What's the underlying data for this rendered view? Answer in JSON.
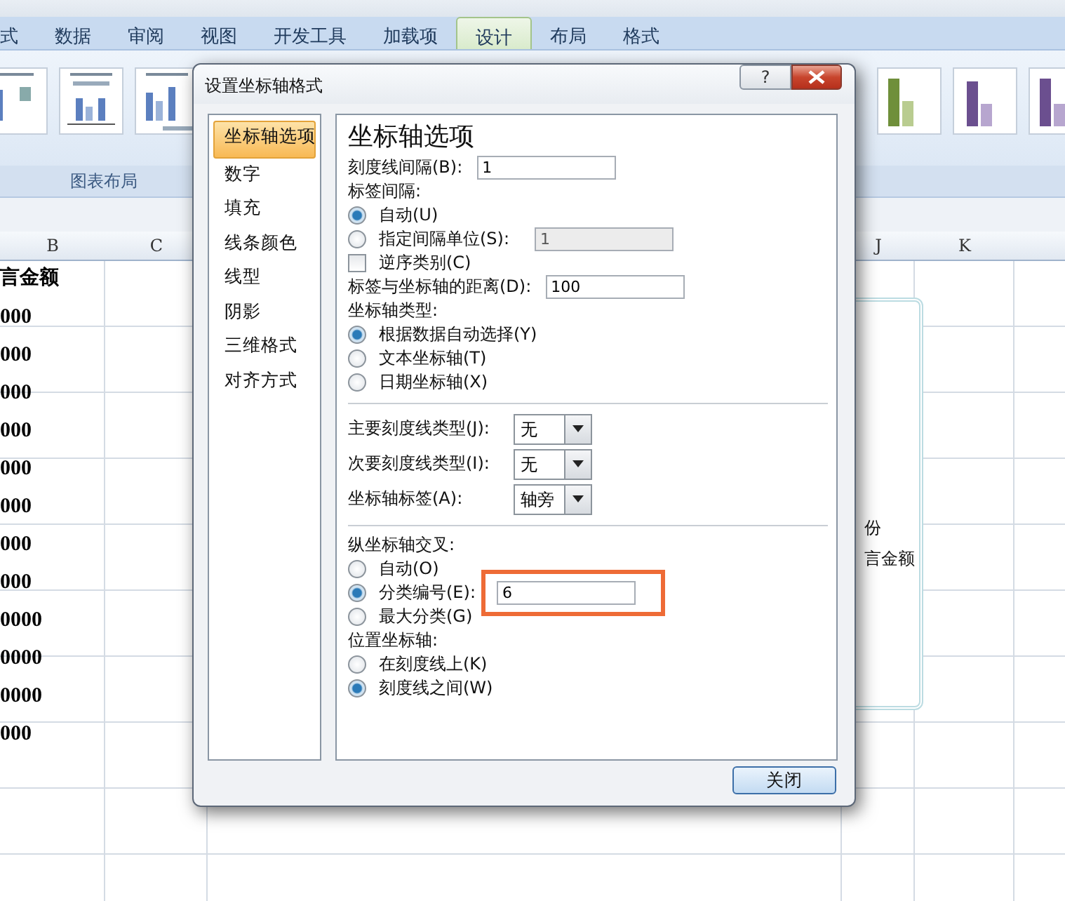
{
  "ribbon": {
    "tabs": [
      {
        "label": "式",
        "selected": false
      },
      {
        "label": "数据",
        "selected": false
      },
      {
        "label": "审阅",
        "selected": false
      },
      {
        "label": "视图",
        "selected": false
      },
      {
        "label": "开发工具",
        "selected": false
      },
      {
        "label": "加载项",
        "selected": false
      },
      {
        "label": "设计",
        "selected": true
      },
      {
        "label": "布局",
        "selected": false
      },
      {
        "label": "格式",
        "selected": false
      }
    ],
    "group_label": "图表布局"
  },
  "sheet": {
    "columns": [
      {
        "label": "B"
      },
      {
        "label": "C"
      },
      {
        "label": "J"
      },
      {
        "label": "K"
      }
    ],
    "column_b": [
      "言金额",
      "000",
      "000",
      "000",
      "000",
      "000",
      "000",
      "000",
      "000",
      "0000",
      "0000",
      "0000",
      "000"
    ],
    "legend": [
      "份",
      "言金额"
    ]
  },
  "dialog": {
    "title": "设置坐标轴格式",
    "help": "?",
    "nav": [
      {
        "label": "坐标轴选项",
        "selected": true
      },
      {
        "label": "数字",
        "selected": false
      },
      {
        "label": "填充",
        "selected": false
      },
      {
        "label": "线条颜色",
        "selected": false
      },
      {
        "label": "线型",
        "selected": false
      },
      {
        "label": "阴影",
        "selected": false
      },
      {
        "label": "三维格式",
        "selected": false
      },
      {
        "label": "对齐方式",
        "selected": false
      }
    ],
    "heading": "坐标轴选项",
    "options": [
      {
        "kind": "field",
        "label": "刻度线间隔(B):",
        "value": "1"
      },
      {
        "kind": "label",
        "label": "标签间隔:"
      },
      {
        "kind": "radio",
        "label": "自动(U)",
        "selected": true
      },
      {
        "kind": "radio",
        "label": "指定间隔单位(S):",
        "selected": false,
        "value": "1",
        "disabled": true
      },
      {
        "kind": "checkbox",
        "label": "逆序类别(C)",
        "checked": false
      },
      {
        "kind": "field",
        "label": "标签与坐标轴的距离(D):",
        "value": "100"
      },
      {
        "kind": "label",
        "label": "坐标轴类型:"
      },
      {
        "kind": "radio",
        "label": "根据数据自动选择(Y)",
        "selected": true
      },
      {
        "kind": "radio",
        "label": "文本坐标轴(T)",
        "selected": false
      },
      {
        "kind": "radio",
        "label": "日期坐标轴(X)",
        "selected": false
      },
      {
        "kind": "separator"
      },
      {
        "kind": "select",
        "label": "主要刻度线类型(J):",
        "value": "无"
      },
      {
        "kind": "select",
        "label": "次要刻度线类型(I):",
        "value": "无"
      },
      {
        "kind": "select",
        "label": "坐标轴标签(A):",
        "value": "轴旁"
      },
      {
        "kind": "separator"
      },
      {
        "kind": "label",
        "label": "纵坐标轴交叉:"
      },
      {
        "kind": "radio",
        "label": "自动(O)",
        "selected": false
      },
      {
        "kind": "radio",
        "label": "分类编号(E):",
        "selected": true,
        "value": "6",
        "highlighted": true
      },
      {
        "kind": "radio",
        "label": "最大分类(G)",
        "selected": false
      },
      {
        "kind": "label",
        "label": "位置坐标轴:"
      },
      {
        "kind": "radio",
        "label": "在刻度线上(K)",
        "selected": false
      },
      {
        "kind": "radio",
        "label": "刻度线之间(W)",
        "selected": true
      }
    ],
    "close_button": "关闭"
  }
}
